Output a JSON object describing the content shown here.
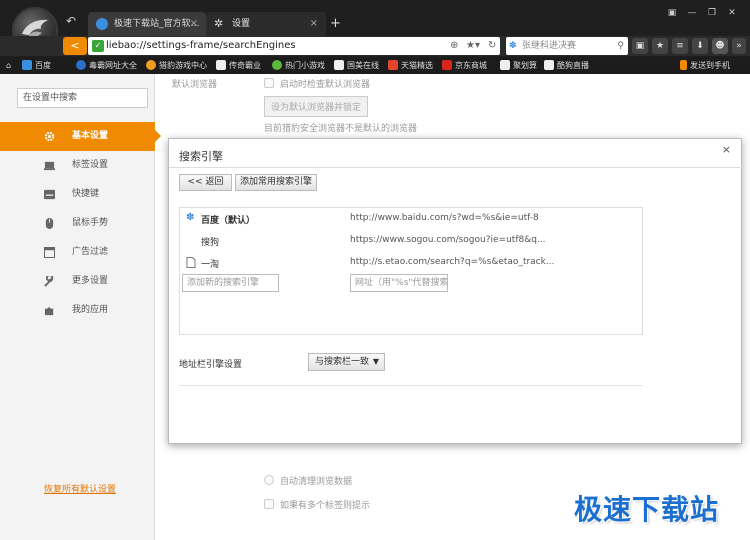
{
  "browser": {
    "tabs": [
      {
        "title": "极速下载站_官方软…",
        "close": "×"
      },
      {
        "title": "设置",
        "close": "×"
      }
    ],
    "new_tab": "+",
    "window_controls": [
      "▣",
      "—",
      "❐",
      "✕"
    ],
    "address": "liebao://settings-frame/searchEngines",
    "search_placeholder": "张继科进决赛",
    "bookmarks": [
      "百度",
      "毒霸网址大全",
      "猎豹游戏中心",
      "传奇霸业",
      "热门小游戏",
      "国美在线",
      "天猫精选",
      "京东商城",
      "聚划算",
      "酷狗直播"
    ],
    "send_to_phone": "发送到手机"
  },
  "sidebar": {
    "search_placeholder": "在设置中搜索",
    "items": [
      {
        "label": "基本设置",
        "icon": "gear-icon",
        "active": true
      },
      {
        "label": "标签设置",
        "icon": "laptop-icon"
      },
      {
        "label": "快捷键",
        "icon": "keyboard-icon"
      },
      {
        "label": "鼠标手势",
        "icon": "mouse-icon"
      },
      {
        "label": "广告过滤",
        "icon": "window-icon"
      },
      {
        "label": "更多设置",
        "icon": "wrench-icon"
      },
      {
        "label": "我的应用",
        "icon": "puzzle-icon"
      }
    ],
    "restore_link": "恢复所有默认设置"
  },
  "background": {
    "default_browser_label": "默认浏览器",
    "check_default": "启动时检查默认浏览器",
    "set_default_btn": "设为默认浏览器并锁定",
    "hint": "目前猎豹安全浏览器不是默认的浏览器",
    "auto_clear": "自动清理浏览数据",
    "multi_tab": "如果有多个标签则提示"
  },
  "dialog": {
    "title": "搜索引擎",
    "close": "×",
    "back_btn": "<< 返回",
    "add_common_btn": "添加常用搜索引擎",
    "engines": [
      {
        "name": "百度（默认）",
        "url": "http://www.baidu.com/s?wd=%s&ie=utf-8",
        "icon": "baidu-paw-icon",
        "bold": true
      },
      {
        "name": "搜狗",
        "url": "https://www.sogou.com/sogou?ie=utf8&q...",
        "icon": "none"
      },
      {
        "name": "一淘",
        "url": "http://s.etao.com/search?q=%s&etao_track...",
        "icon": "document-icon"
      }
    ],
    "new_name_placeholder": "添加新的搜索引擎",
    "new_url_placeholder": "网址（用\"%s\"代替搜索字",
    "address_bar_label": "地址栏引擎设置",
    "address_bar_value": "与搜索栏一致"
  },
  "watermark": "极速下载站",
  "colors": {
    "accent": "#f08a00",
    "watermark": "#1a6fcf"
  }
}
